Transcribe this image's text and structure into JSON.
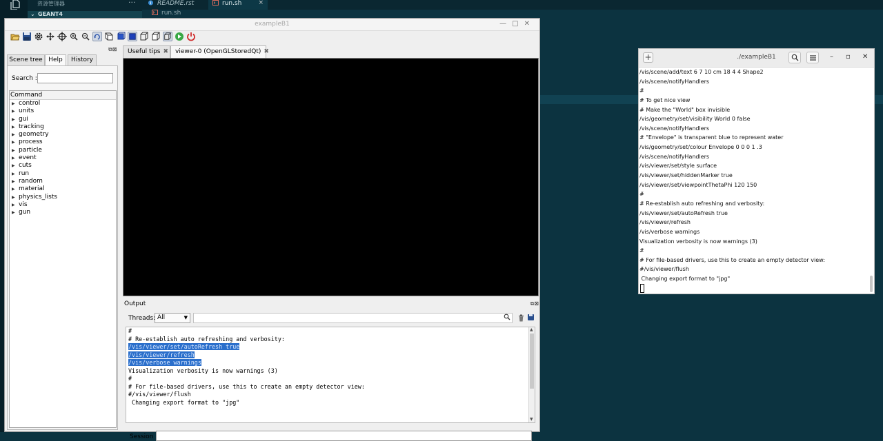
{
  "editor": {
    "explorer_title": "资源管理器",
    "explorer_folder": "GEANT4",
    "tabs": [
      {
        "label": "README.rst"
      },
      {
        "label": "run.sh"
      }
    ],
    "tab_close": "×",
    "breadcrumb": "run.sh"
  },
  "app": {
    "title": "exampleB1",
    "toolbar_icons": [
      "open-icon",
      "save-icon",
      "gear-icon",
      "move-icon",
      "crosshair-icon",
      "zoom-in-icon",
      "zoom-out-icon",
      "rotate-icon",
      "perspective-icon",
      "ortho-icon",
      "solid-icon",
      "wireframe-icon",
      "hidden-line-icon",
      "surface-icon",
      "pick-icon",
      "run-icon",
      "exit-icon"
    ]
  },
  "left_dock": {
    "tabs": [
      "Scene tree",
      "Help",
      "History"
    ],
    "active_tab": "Help",
    "search_label": "Search :",
    "search_value": "",
    "tree_header": "Command",
    "commands": [
      "control",
      "units",
      "gui",
      "tracking",
      "geometry",
      "process",
      "particle",
      "event",
      "cuts",
      "run",
      "random",
      "material",
      "physics_lists",
      "vis",
      "gun"
    ]
  },
  "center_tabs": [
    {
      "label": "Useful tips"
    },
    {
      "label": "viewer-0 (OpenGLStoredQt)"
    }
  ],
  "tab_close": "✖",
  "output": {
    "title": "Output",
    "threads_label": "Threads:",
    "threads_value": "All",
    "lines": [
      {
        "text": "#",
        "selected": false
      },
      {
        "text": "# Re-establish auto refreshing and verbosity:",
        "selected": false
      },
      {
        "text": "/vis/viewer/set/autoRefresh true",
        "selected": true
      },
      {
        "text": "/vis/viewer/refresh",
        "selected": true
      },
      {
        "text": "/vis/verbose warnings",
        "selected": true
      },
      {
        "text": "Visualization verbosity is now warnings (3)",
        "selected": false
      },
      {
        "text": "#",
        "selected": false
      },
      {
        "text": "# For file-based drivers, use this to create an empty detector view:",
        "selected": false
      },
      {
        "text": "#/vis/viewer/flush",
        "selected": false
      },
      {
        "text": " Changing export format to \"jpg\"",
        "selected": false
      }
    ],
    "session_label": "Session :",
    "session_value": ""
  },
  "terminal": {
    "title": "./exampleB1",
    "lines": [
      "/vis/scene/add/text 6 7 10 cm 18 4 4 Shape2",
      "/vis/scene/notifyHandlers",
      "#",
      "# To get nice view",
      "# Make the \"World\" box invisible",
      "/vis/geometry/set/visibility World 0 false",
      "/vis/scene/notifyHandlers",
      "# \"Envelope\" is transparent blue to represent water",
      "/vis/geometry/set/colour Envelope 0 0 0 1 .3",
      "/vis/scene/notifyHandlers",
      "/vis/viewer/set/style surface",
      "/vis/viewer/set/hiddenMarker true",
      "/vis/viewer/set/viewpointThetaPhi 120 150",
      "#",
      "# Re-establish auto refreshing and verbosity:",
      "/vis/viewer/set/autoRefresh true",
      "/vis/viewer/refresh",
      "/vis/verbose warnings",
      "Visualization verbosity is now warnings (3)",
      "#",
      "# For file-based drivers, use this to create an empty detector view:",
      "#/vis/viewer/flush",
      " Changing export format to \"jpg\""
    ]
  }
}
